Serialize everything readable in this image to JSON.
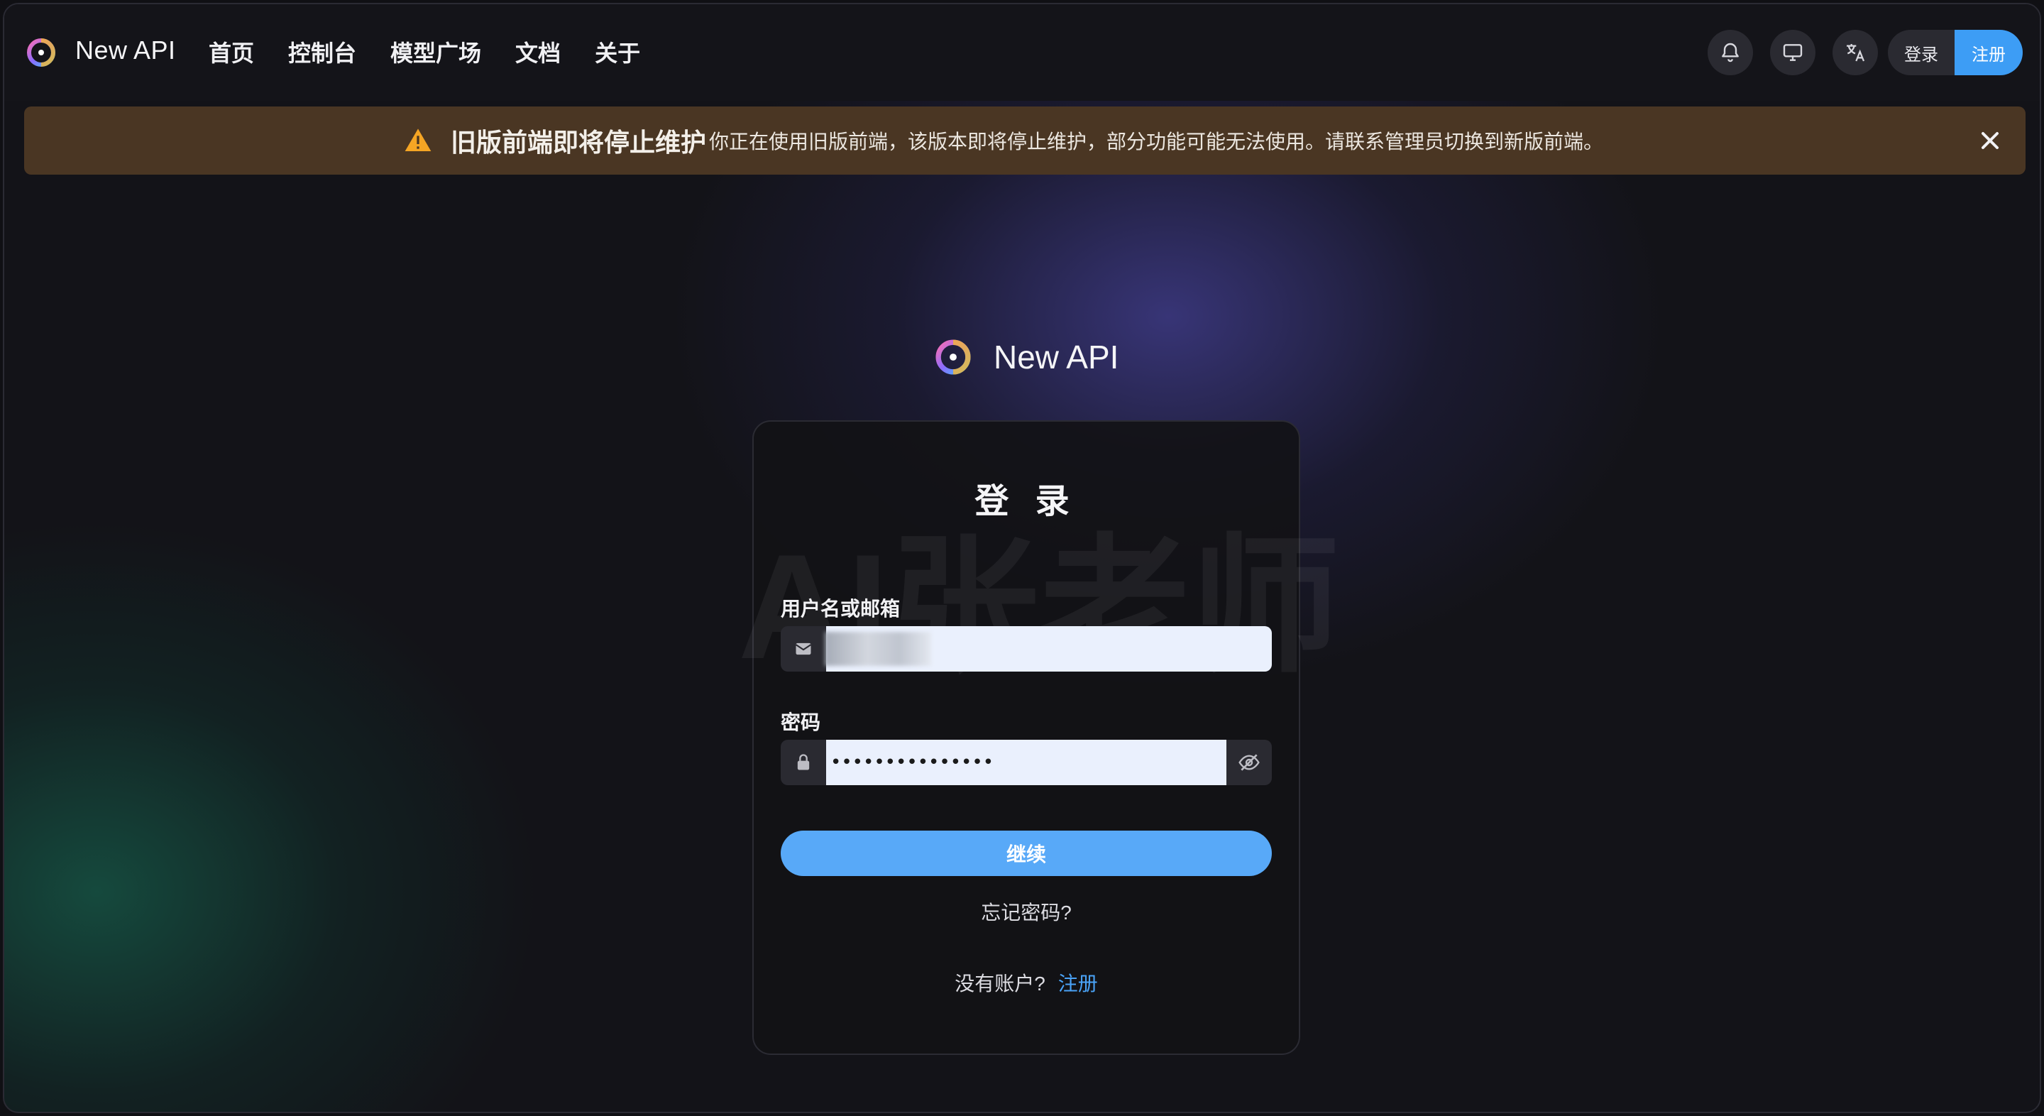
{
  "app": {
    "brand": "New API"
  },
  "nav": {
    "items": [
      "首页",
      "控制台",
      "模型广场",
      "文档",
      "关于"
    ]
  },
  "header_actions": {
    "icons": [
      "bell-icon",
      "monitor-icon",
      "translate-icon"
    ],
    "login_label": "登录",
    "register_label": "注册"
  },
  "banner": {
    "icon": "warning-icon",
    "title": "旧版前端即将停止维护",
    "message": "你正在使用旧版前端，该版本即将停止维护，部分功能可能无法使用。请联系管理员切换到新版前端。"
  },
  "login": {
    "brand": "New API",
    "title": "登 录",
    "watermark": "AI张老师",
    "username": {
      "label": "用户名或邮箱",
      "value": ""
    },
    "password": {
      "label": "密码",
      "value": "•••••••••••••••"
    },
    "submit_label": "继续",
    "forgot_label": "忘记密码?",
    "no_account_text": "没有账户?",
    "register_link": "注册"
  },
  "colors": {
    "accent": "#3d9df5",
    "banner_bg": "#4a3623",
    "warning": "#f5a524"
  }
}
